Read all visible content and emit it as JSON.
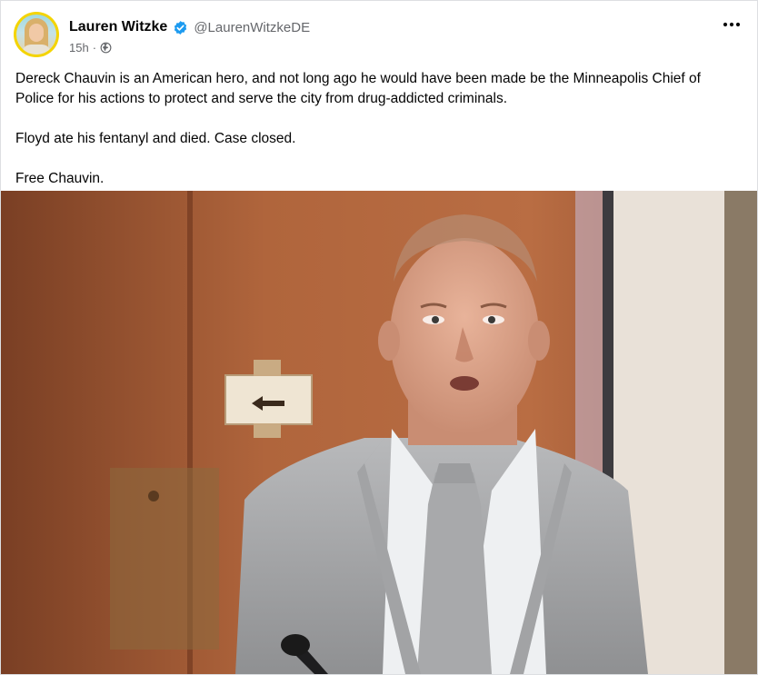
{
  "post": {
    "author": {
      "display_name": "Lauren Witzke",
      "handle": "@LaurenWitzkeDE",
      "verified": true,
      "avatar_icon": "profile-avatar"
    },
    "meta": {
      "time": "15h",
      "separator": "·",
      "audience_icon": "public-globe-icon"
    },
    "more_icon": "more-options-icon",
    "paragraphs": [
      "Dereck Chauvin is an American hero, and not long ago he would have been made be the Minneapolis Chief of Police for his actions to protect and serve the city from drug-addicted criminals.",
      "Floyd ate his fentanyl and died. Case closed.",
      "Free Chauvin."
    ],
    "photo_icon": "attached-photo"
  },
  "colors": {
    "verified_blue": "#1d9bf0",
    "secondary_text": "#65676b",
    "avatar_ring": "#f4d400"
  }
}
